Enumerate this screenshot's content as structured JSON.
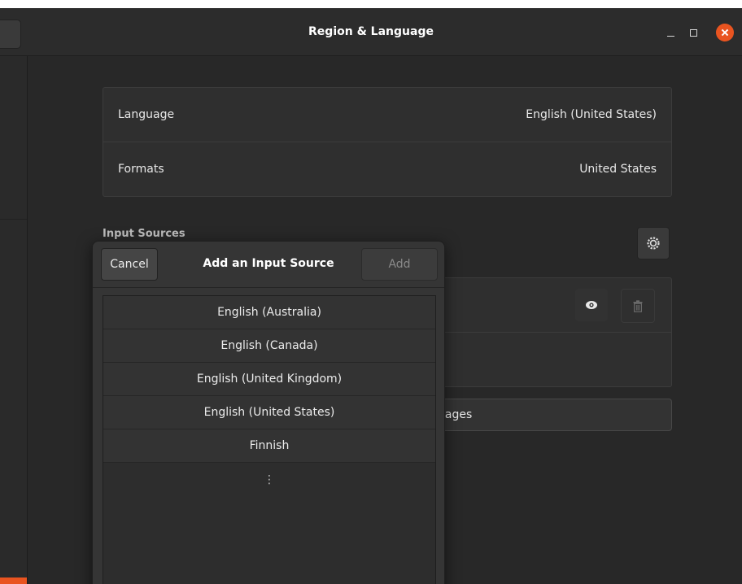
{
  "window": {
    "title": "Region & Language",
    "controls": {
      "minimize": "minimize-icon",
      "maximize": "maximize-icon",
      "close": "close-icon",
      "close_color": "#e95420"
    }
  },
  "settings": {
    "language_label": "Language",
    "language_value": "English (United States)",
    "formats_label": "Formats",
    "formats_value": "United States"
  },
  "input_sources": {
    "section_title": "Input Sources",
    "manage_label": "uages"
  },
  "dialog": {
    "cancel_label": "Cancel",
    "title": "Add an Input Source",
    "add_label": "Add",
    "items": [
      "English (Australia)",
      "English (Canada)",
      "English (United Kingdom)",
      "English (United States)",
      "Finnish"
    ],
    "more": "⋮"
  },
  "colors": {
    "accent": "#e95420",
    "background": "#282828",
    "card": "#2f2f2f"
  }
}
